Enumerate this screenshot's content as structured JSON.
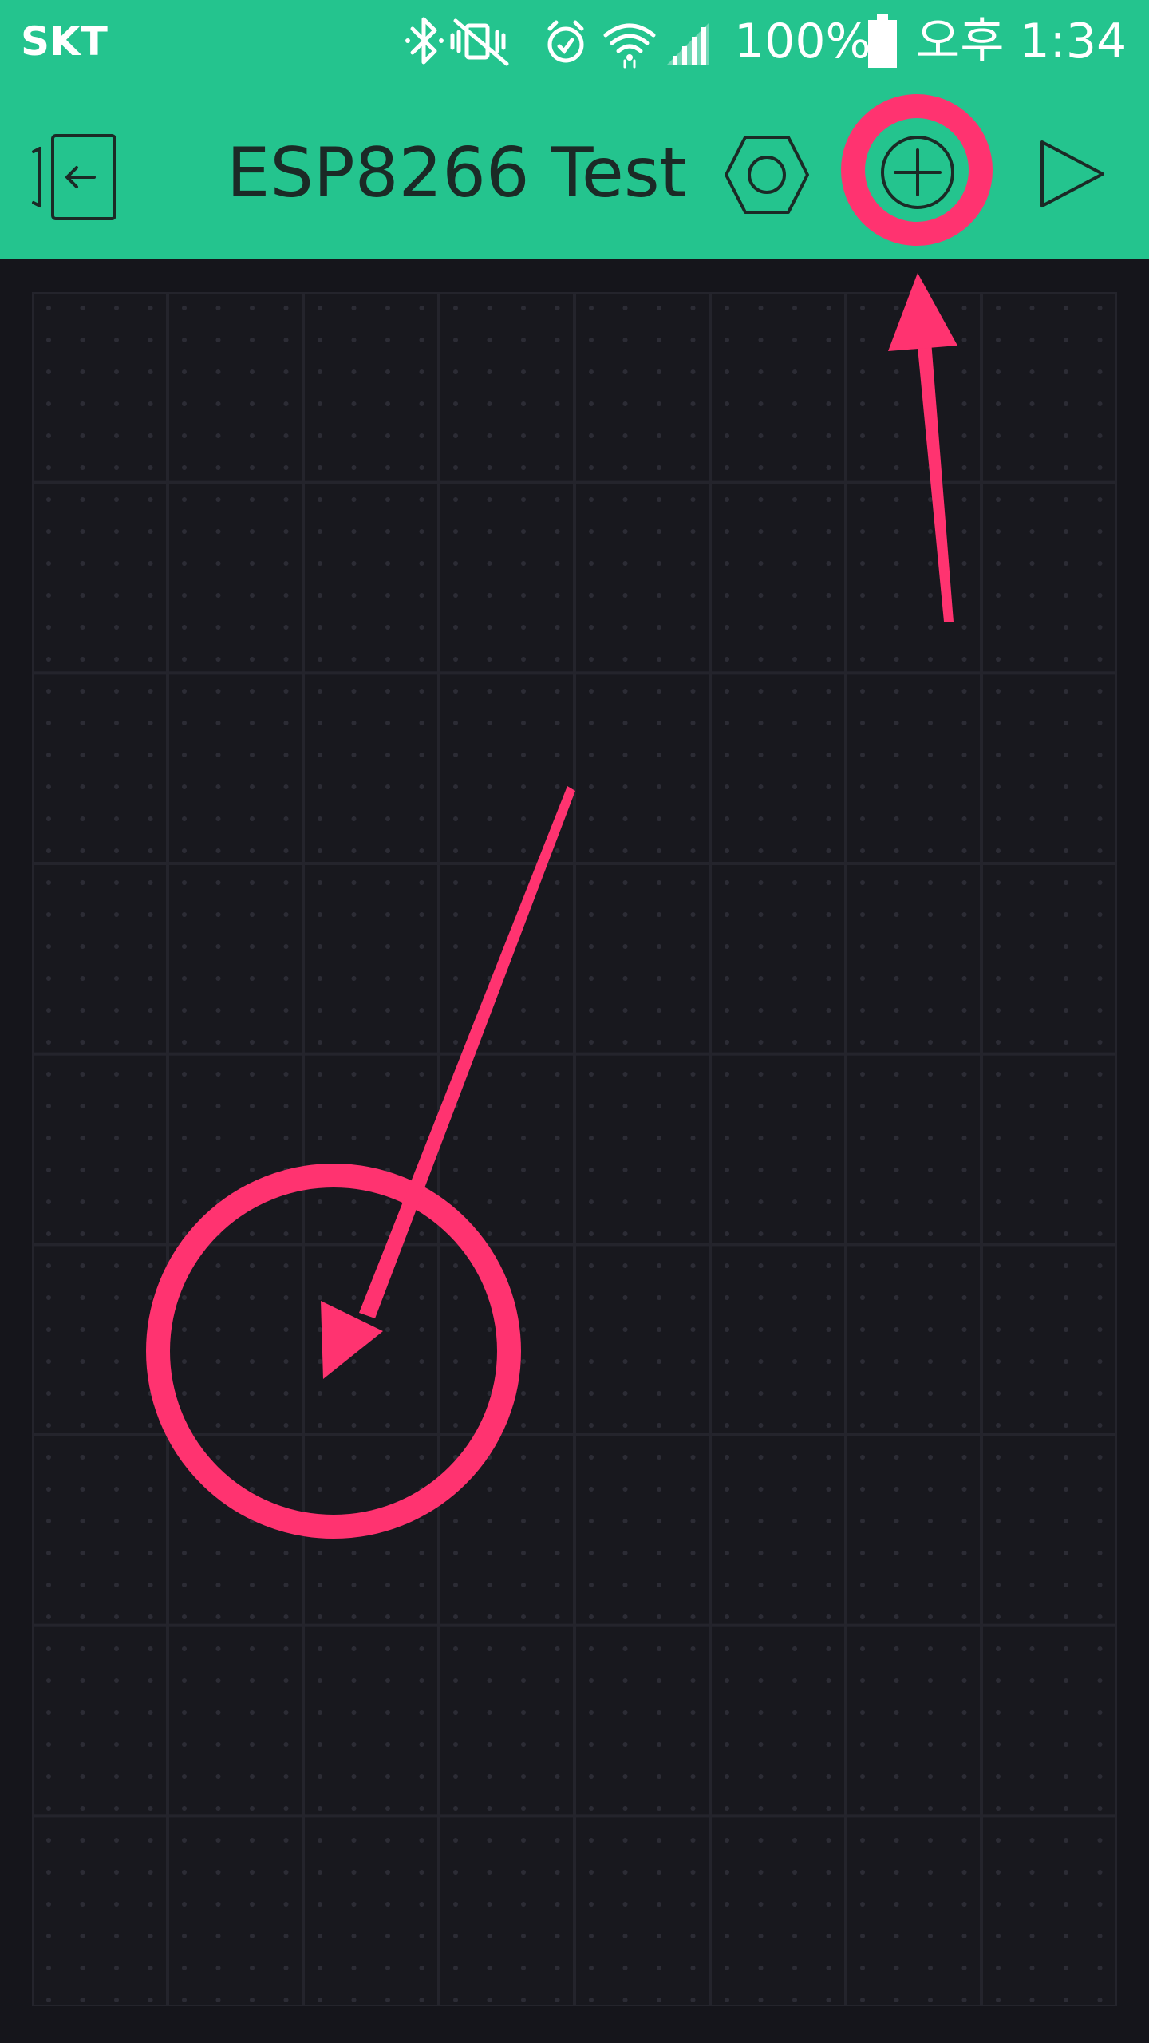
{
  "status_bar": {
    "carrier": "SKT",
    "battery_percent": "100%",
    "time": "오후 1:34",
    "icons": [
      "bluetooth-icon",
      "vibrate-mute-icon",
      "alarm-icon",
      "wifi-icon",
      "cellular-signal-icon",
      "battery-icon"
    ]
  },
  "app_bar": {
    "title": "ESP8266 Test",
    "actions": [
      "exit-project-icon",
      "settings-hexagon-icon",
      "add-widget-icon",
      "play-icon"
    ]
  },
  "colors": {
    "brand": "#24c48e",
    "canvas_background": "#15151b",
    "grid_line": "#24242c",
    "grid_dot": "#2c2c35",
    "annotation": "#ff3370",
    "icon_dark": "#1b2a26"
  },
  "annotations": [
    {
      "type": "circle",
      "target": "add-widget-button"
    },
    {
      "type": "arrow",
      "target": "add-widget-button"
    },
    {
      "type": "circle",
      "target": "widget-canvas"
    },
    {
      "type": "arrow",
      "target": "widget-canvas"
    }
  ]
}
